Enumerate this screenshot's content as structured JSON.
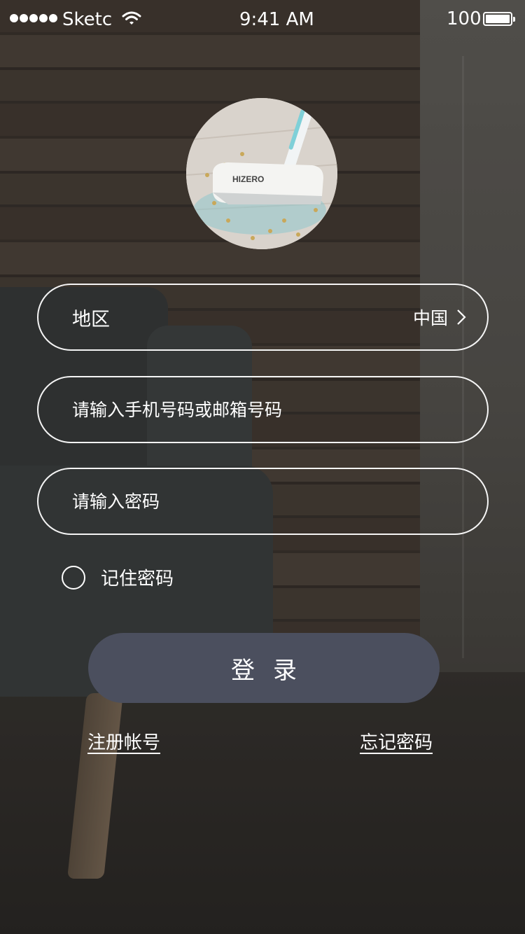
{
  "status_bar": {
    "carrier": "Sketc",
    "time": "9:41 AM",
    "battery": "100"
  },
  "product": {
    "brand": "HIZERO"
  },
  "form": {
    "region_label": "地区",
    "region_value": "中国",
    "account_placeholder": "请输入手机号码或邮箱号码",
    "password_placeholder": "请输入密码",
    "remember_label": "记住密码"
  },
  "login_button": "登录",
  "links": {
    "register": "注册帐号",
    "forgot": "忘记密码"
  },
  "colors": {
    "button_bg": "#4b4f5e",
    "border": "#ffffff"
  }
}
